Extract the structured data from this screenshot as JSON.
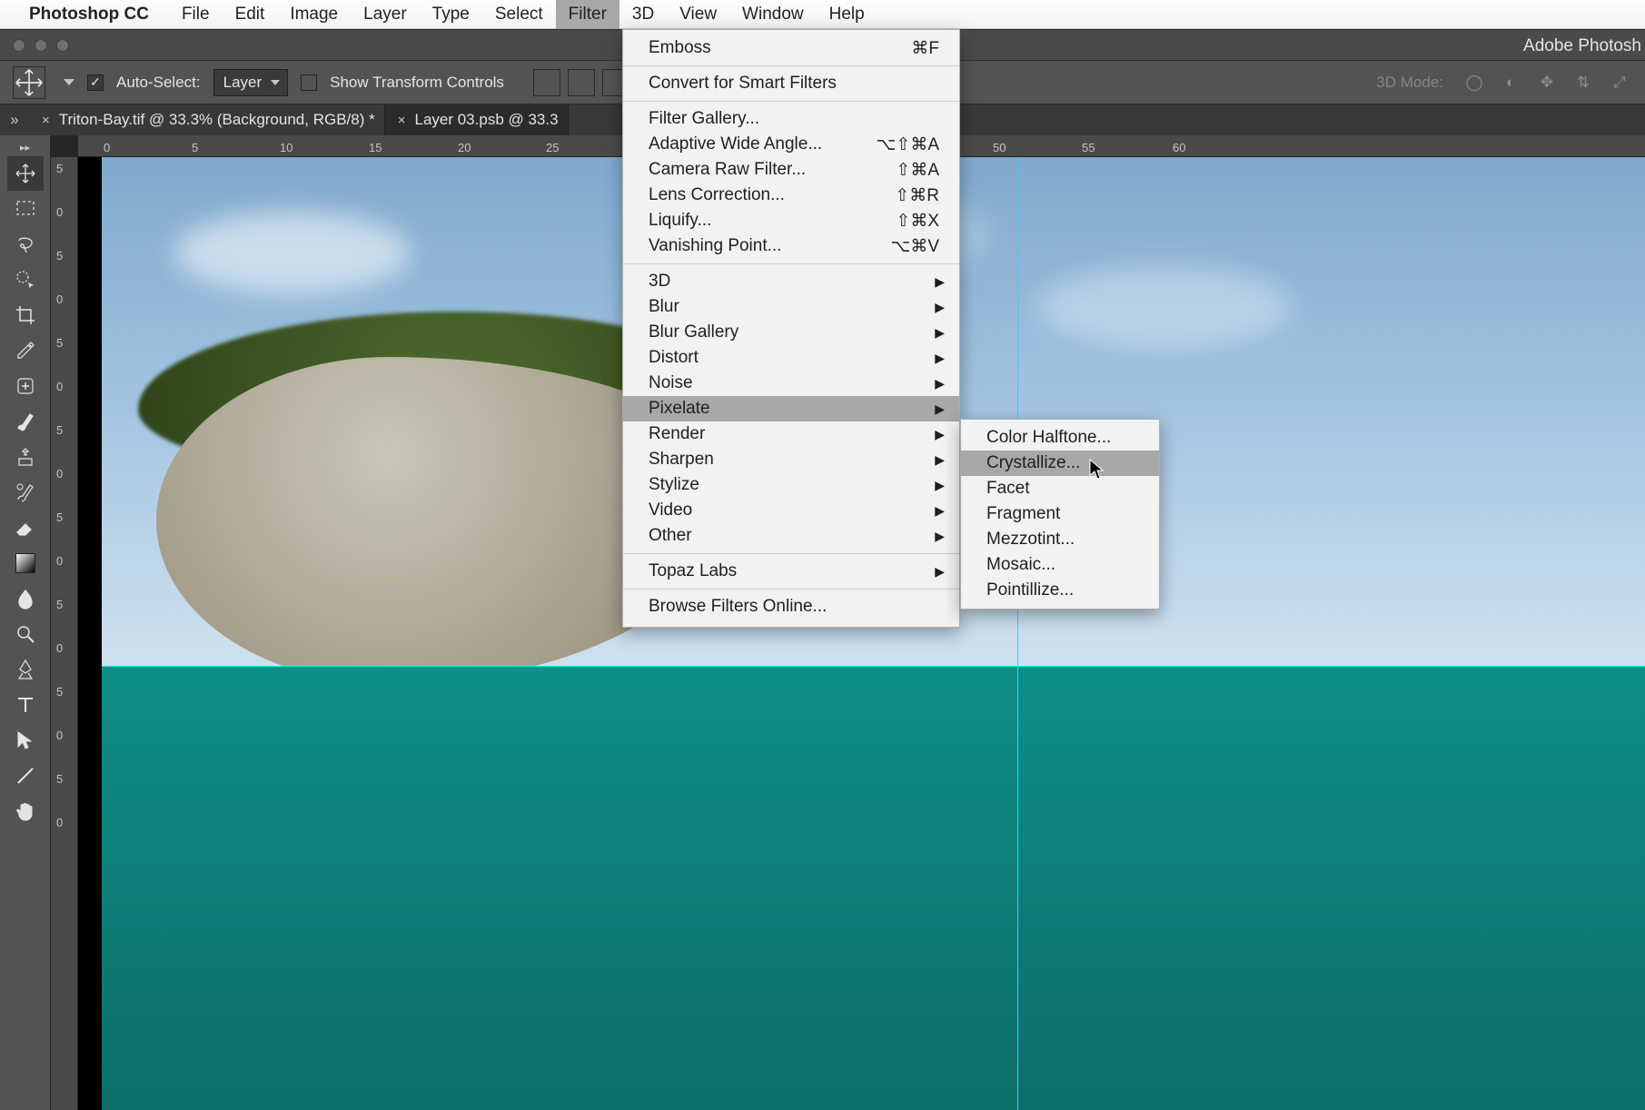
{
  "menubar": {
    "app": "Photoshop CC",
    "items": [
      "File",
      "Edit",
      "Image",
      "Layer",
      "Type",
      "Select",
      "Filter",
      "3D",
      "View",
      "Window",
      "Help"
    ],
    "active": "Filter"
  },
  "window_title": "Adobe Photosh",
  "options_bar": {
    "auto_select_label": "Auto-Select:",
    "auto_select_checked": true,
    "target": "Layer",
    "show_transform_label": "Show Transform Controls",
    "show_transform_checked": false,
    "mode3d_label": "3D Mode:"
  },
  "tabs": {
    "items": [
      {
        "label": "Triton-Bay.tif @ 33.3% (Background, RGB/8) *",
        "active": false
      },
      {
        "label": "Layer 03.psb @ 33.3",
        "active": true
      }
    ]
  },
  "ruler": {
    "h": [
      "0",
      "5",
      "10",
      "15",
      "20",
      "25",
      "50",
      "55",
      "60"
    ],
    "v": [
      "5",
      "0",
      "5",
      "0",
      "5",
      "0",
      "5",
      "0",
      "5",
      "0",
      "5",
      "0",
      "5",
      "0",
      "5",
      "0"
    ]
  },
  "tools": [
    "move-tool",
    "rect-marquee-tool",
    "lasso-tool",
    "quick-select-tool",
    "crop-tool",
    "eyedropper-tool",
    "heal-tool",
    "brush-tool",
    "clone-stamp-tool",
    "history-brush-tool",
    "eraser-tool",
    "gradient-tool",
    "blur-tool",
    "dodge-tool",
    "pen-tool",
    "type-tool",
    "path-select-tool",
    "line-tool",
    "hand-tool"
  ],
  "filter_menu": {
    "sections": [
      [
        {
          "label": "Emboss",
          "shortcut": "⌘F"
        }
      ],
      [
        {
          "label": "Convert for Smart Filters"
        }
      ],
      [
        {
          "label": "Filter Gallery..."
        },
        {
          "label": "Adaptive Wide Angle...",
          "shortcut": "⌥⇧⌘A"
        },
        {
          "label": "Camera Raw Filter...",
          "shortcut": "⇧⌘A"
        },
        {
          "label": "Lens Correction...",
          "shortcut": "⇧⌘R"
        },
        {
          "label": "Liquify...",
          "shortcut": "⇧⌘X"
        },
        {
          "label": "Vanishing Point...",
          "shortcut": "⌥⌘V"
        }
      ],
      [
        {
          "label": "3D",
          "submenu": true
        },
        {
          "label": "Blur",
          "submenu": true
        },
        {
          "label": "Blur Gallery",
          "submenu": true
        },
        {
          "label": "Distort",
          "submenu": true
        },
        {
          "label": "Noise",
          "submenu": true
        },
        {
          "label": "Pixelate",
          "submenu": true,
          "highlight": true
        },
        {
          "label": "Render",
          "submenu": true
        },
        {
          "label": "Sharpen",
          "submenu": true
        },
        {
          "label": "Stylize",
          "submenu": true
        },
        {
          "label": "Video",
          "submenu": true
        },
        {
          "label": "Other",
          "submenu": true
        }
      ],
      [
        {
          "label": "Topaz Labs",
          "submenu": true
        }
      ],
      [
        {
          "label": "Browse Filters Online..."
        }
      ]
    ]
  },
  "pixelate_submenu": {
    "items": [
      {
        "label": "Color Halftone..."
      },
      {
        "label": "Crystallize...",
        "highlight": true
      },
      {
        "label": "Facet"
      },
      {
        "label": "Fragment"
      },
      {
        "label": "Mezzotint..."
      },
      {
        "label": "Mosaic..."
      },
      {
        "label": "Pointillize..."
      }
    ]
  }
}
